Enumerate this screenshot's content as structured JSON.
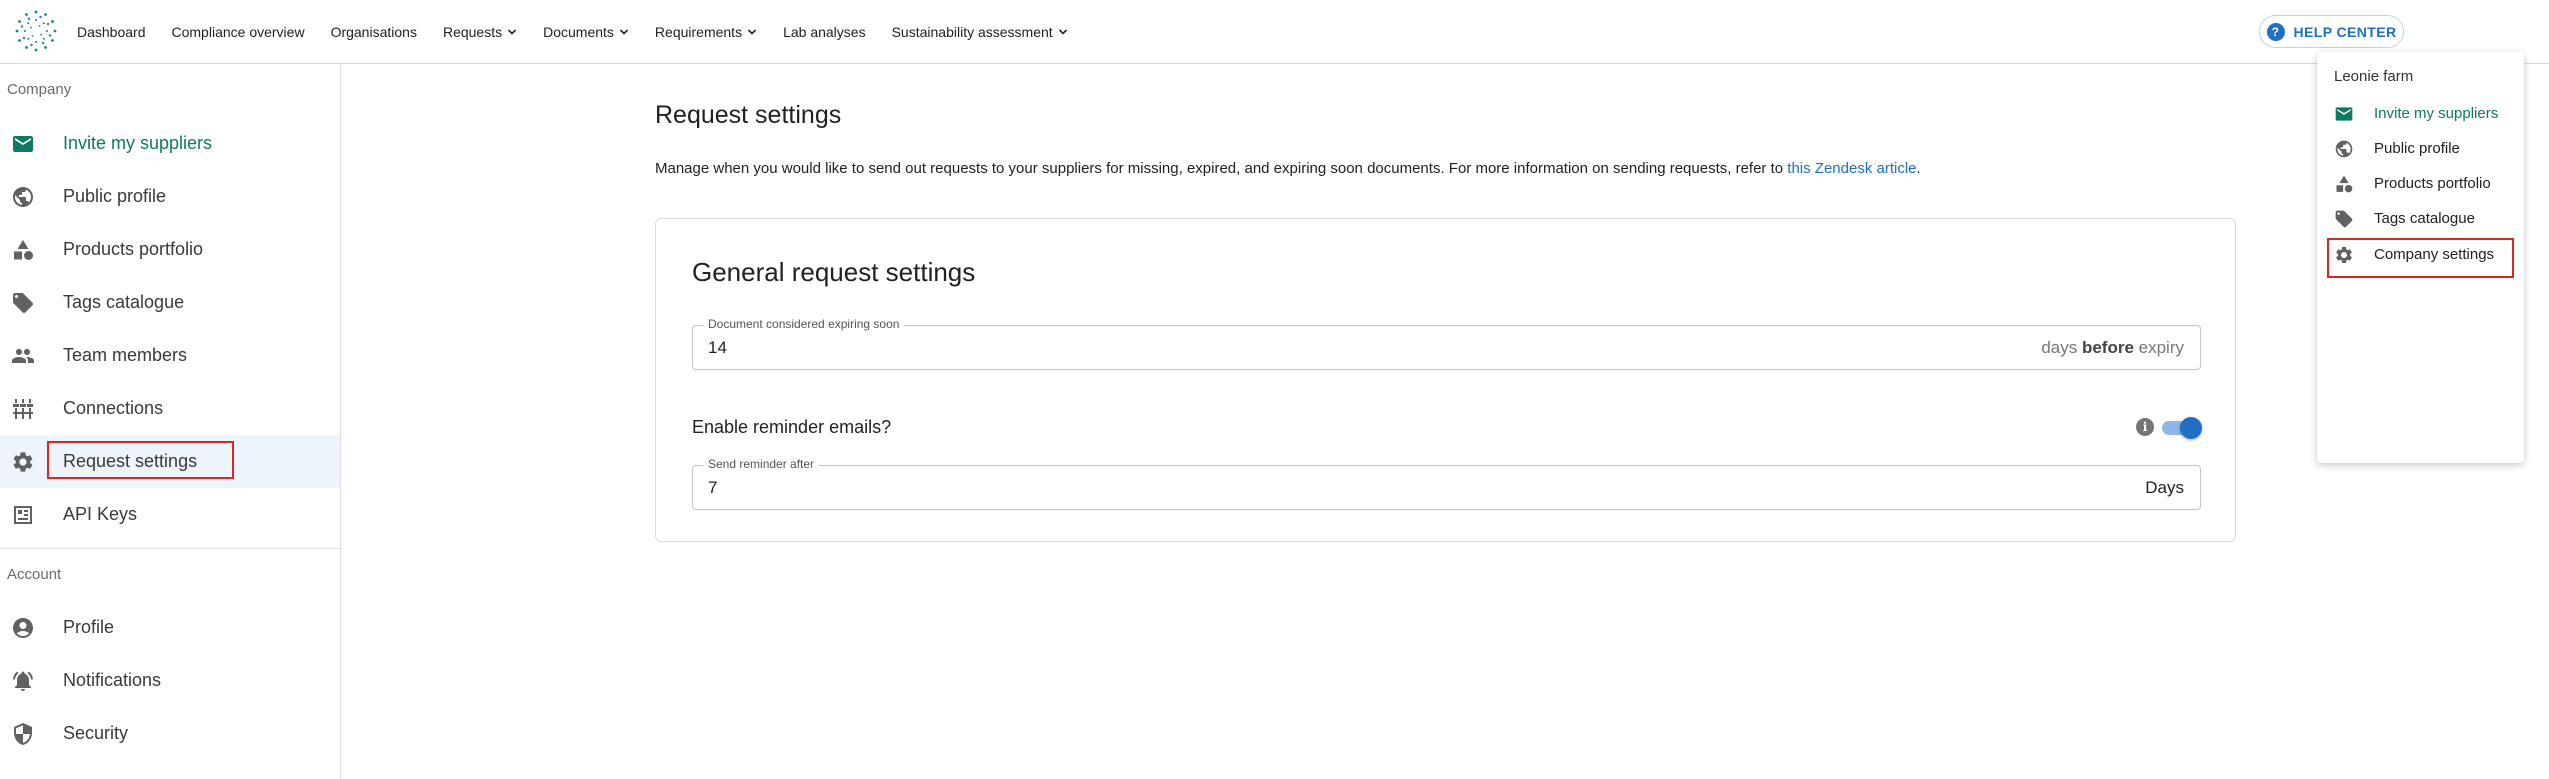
{
  "nav": {
    "items": [
      {
        "label": "Dashboard",
        "dropdown": false
      },
      {
        "label": "Compliance overview",
        "dropdown": false
      },
      {
        "label": "Organisations",
        "dropdown": false
      },
      {
        "label": "Requests",
        "dropdown": true
      },
      {
        "label": "Documents",
        "dropdown": true
      },
      {
        "label": "Requirements",
        "dropdown": true
      },
      {
        "label": "Lab analyses",
        "dropdown": false
      },
      {
        "label": "Sustainability assessment",
        "dropdown": true
      }
    ],
    "help_label": "HELP CENTER"
  },
  "sidebar": {
    "company_section": "Company",
    "account_section": "Account",
    "company_items": [
      {
        "label": "Invite my suppliers",
        "icon": "mail-icon"
      },
      {
        "label": "Public profile",
        "icon": "globe-icon"
      },
      {
        "label": "Products portfolio",
        "icon": "shapes-icon"
      },
      {
        "label": "Tags catalogue",
        "icon": "tag-icon"
      },
      {
        "label": "Team members",
        "icon": "people-icon"
      },
      {
        "label": "Connections",
        "icon": "connections-icon"
      },
      {
        "label": "Request settings",
        "icon": "gear-icon"
      },
      {
        "label": "API Keys",
        "icon": "api-key-icon"
      }
    ],
    "account_items": [
      {
        "label": "Profile",
        "icon": "account-circle-icon"
      },
      {
        "label": "Notifications",
        "icon": "bell-icon"
      },
      {
        "label": "Security",
        "icon": "shield-icon"
      }
    ],
    "active_item": "Request settings"
  },
  "main": {
    "title": "Request settings",
    "description_prefix": "Manage when you would like to send out requests to your suppliers for missing, expired, and expiring soon documents. For more information on sending requests, refer to ",
    "description_link": "this Zendesk article",
    "description_suffix": ".",
    "card": {
      "title": "General request settings",
      "expiring_field": {
        "label": "Document considered expiring soon",
        "value": "14",
        "suffix_pre": "days ",
        "suffix_bold": "before",
        "suffix_post": " expiry"
      },
      "reminder_toggle": {
        "label": "Enable reminder emails?",
        "enabled": true
      },
      "reminder_field": {
        "label": "Send reminder after",
        "value": "7",
        "suffix": "Days"
      }
    }
  },
  "menu": {
    "header": "Leonie farm",
    "items": [
      {
        "label": "Invite my suppliers",
        "icon": "mail-icon"
      },
      {
        "label": "Public profile",
        "icon": "globe-icon"
      },
      {
        "label": "Products portfolio",
        "icon": "shapes-icon"
      },
      {
        "label": "Tags catalogue",
        "icon": "tag-icon"
      },
      {
        "label": "Company settings",
        "icon": "gear-icon"
      }
    ]
  },
  "colors": {
    "accent_green": "#0d7a64",
    "link_blue": "#1f6fc5",
    "highlight_red": "#e02424",
    "active_bg": "#eef4fb"
  }
}
